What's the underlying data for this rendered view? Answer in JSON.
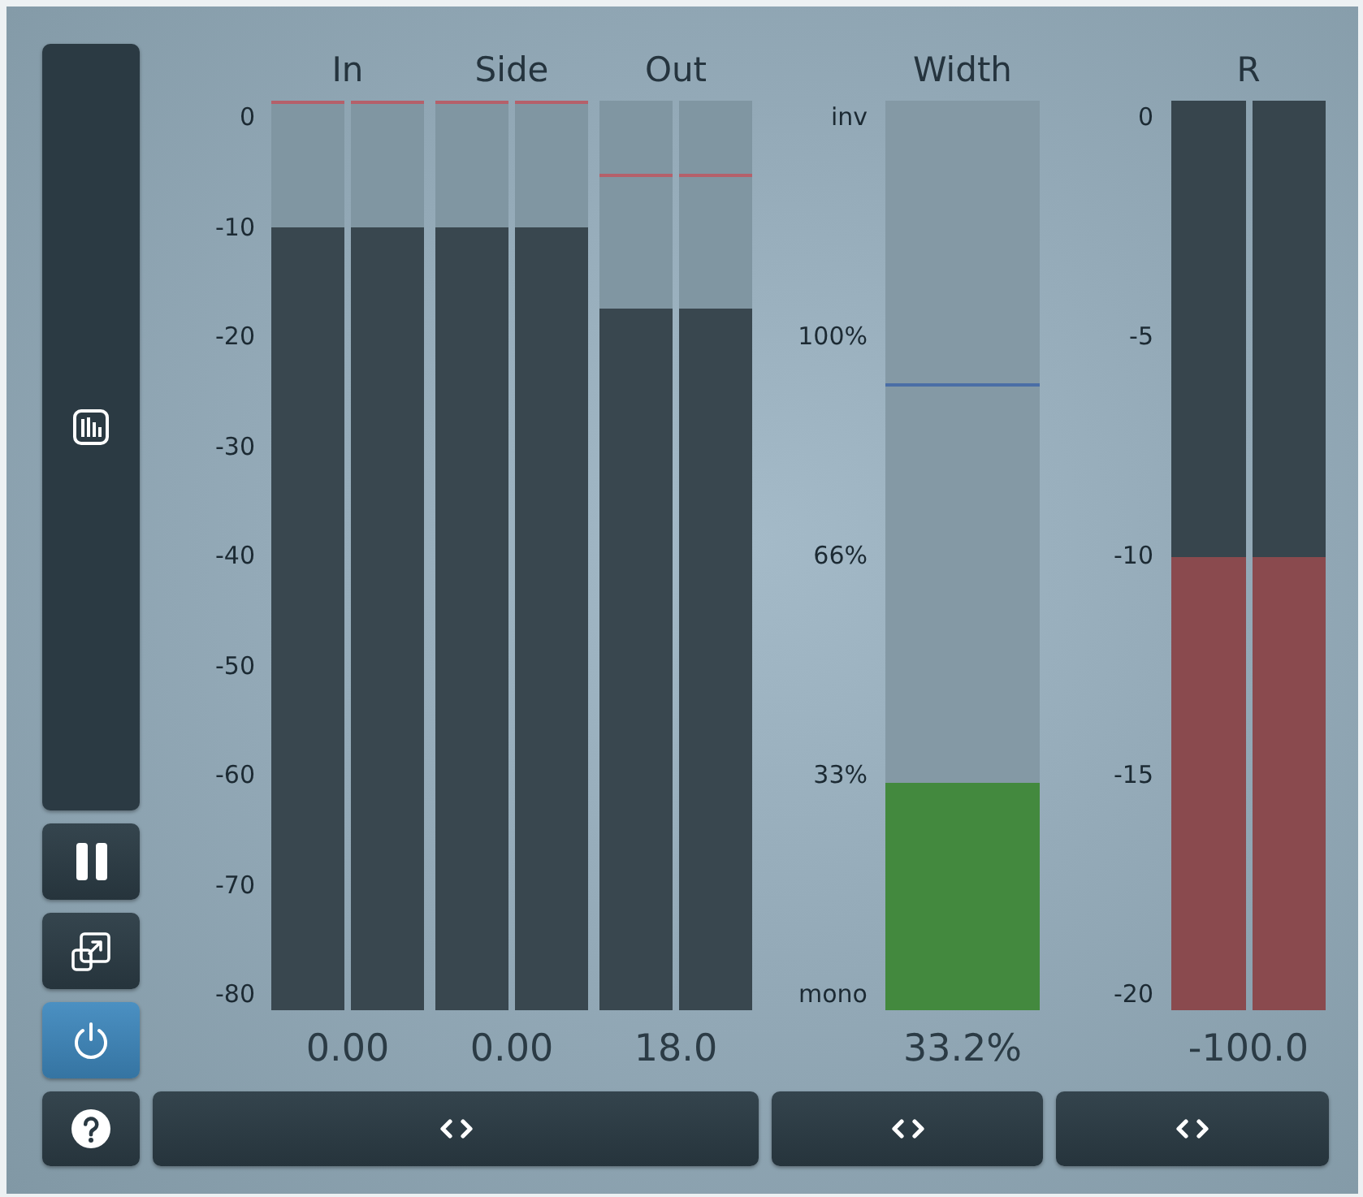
{
  "sidebar": {
    "power_button": {
      "on": true
    }
  },
  "level_meters": {
    "scale": [
      "0",
      "-10",
      "-20",
      "-30",
      "-40",
      "-50",
      "-60",
      "-70",
      "-80"
    ],
    "meters": [
      {
        "title": "In",
        "channels": [
          {
            "level": 0.861,
            "peak": {
              "level": 1
            }
          },
          {
            "level": 0.861,
            "peak": {
              "level": 1
            }
          }
        ],
        "reading": "0.00"
      },
      {
        "title": "Side",
        "channels": [
          {
            "level": 0.861,
            "peak": {
              "level": 1
            }
          },
          {
            "level": 0.861,
            "peak": {
              "level": 1
            }
          }
        ],
        "reading": "0.00"
      },
      {
        "title": "Out",
        "channels": [
          {
            "level": 0.771,
            "peak": {
              "level": 0.92
            }
          },
          {
            "level": 0.771,
            "peak": {
              "level": 0.92
            }
          }
        ],
        "reading": "18.0"
      }
    ]
  },
  "width_meter": {
    "title": "Width",
    "scale": [
      "inv",
      "100%",
      "66%",
      "33%",
      "mono"
    ],
    "level": 0.25,
    "marker": {
      "level": 0.689
    },
    "reading": "33.2%"
  },
  "r_meter": {
    "title": "R",
    "scale": [
      "0",
      "-5",
      "-10",
      "-15",
      "-20"
    ],
    "channels": [
      {
        "level": 0.498
      },
      {
        "level": 0.498
      }
    ],
    "reading": "-100.0"
  }
}
